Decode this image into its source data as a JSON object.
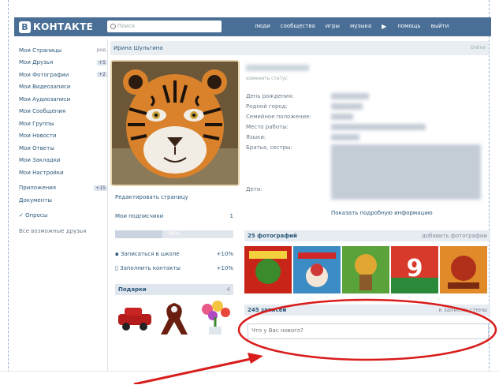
{
  "logo": {
    "letter": "B",
    "text": "КОНТАКТЕ"
  },
  "search": {
    "placeholder": "Поиск"
  },
  "topnav": {
    "items": [
      "люди",
      "сообщества",
      "игры",
      "музыка",
      "помощь",
      "выйти"
    ]
  },
  "sidebar": {
    "items": [
      {
        "label": "Мои Страницы",
        "badge": "ред."
      },
      {
        "label": "Мои Друзья",
        "badge": "+5"
      },
      {
        "label": "Мои Фотографии",
        "badge": "+2"
      },
      {
        "label": "Мои Видеозаписи",
        "badge": ""
      },
      {
        "label": "Мои Аудиозаписи",
        "badge": ""
      },
      {
        "label": "Мои Сообщения",
        "badge": ""
      },
      {
        "label": "Мои Группы",
        "badge": ""
      },
      {
        "label": "Мои Новости",
        "badge": ""
      },
      {
        "label": "Мои Ответы",
        "badge": ""
      },
      {
        "label": "Мои Закладки",
        "badge": ""
      },
      {
        "label": "Мои Настройки",
        "badge": ""
      }
    ],
    "apps_label": "Приложения",
    "apps_badge": "+15",
    "docs_label": "Документы",
    "opinions_label": "✓ Опросы",
    "invite_label": "Все возможные друзья"
  },
  "profile": {
    "name": "Ирина Шульгина",
    "online": "Online",
    "status_change": "изменить статус",
    "info_labels": [
      "День рождения:",
      "Родной город:",
      "Семейное положение:",
      "Место работы:",
      "Языки:",
      "Братья, сестры:"
    ],
    "children_label": "Дети:",
    "more_info": "Показать подробную информацию"
  },
  "left": {
    "edit_page": "Редактировать страницу",
    "subscribers": "Мои подписчики",
    "subscribers_count": "1",
    "progress_label": "40%",
    "progress_value": 0.4,
    "tasks": [
      {
        "label": "Записаться в школе",
        "pct": "+10%"
      },
      {
        "label": "Заполнить контакты",
        "pct": "+10%"
      }
    ],
    "gifts_title": "Подарки",
    "gifts_count": "4"
  },
  "photos": {
    "title": "25 фотографий",
    "add": "добавить фотографии"
  },
  "wall": {
    "title": "245 записей",
    "link": "к записям стены",
    "placeholder": "Что у Вас нового?"
  },
  "colors": {
    "header": "#4a6f96",
    "link": "#2b587a",
    "annotation": "#d91c1c"
  }
}
